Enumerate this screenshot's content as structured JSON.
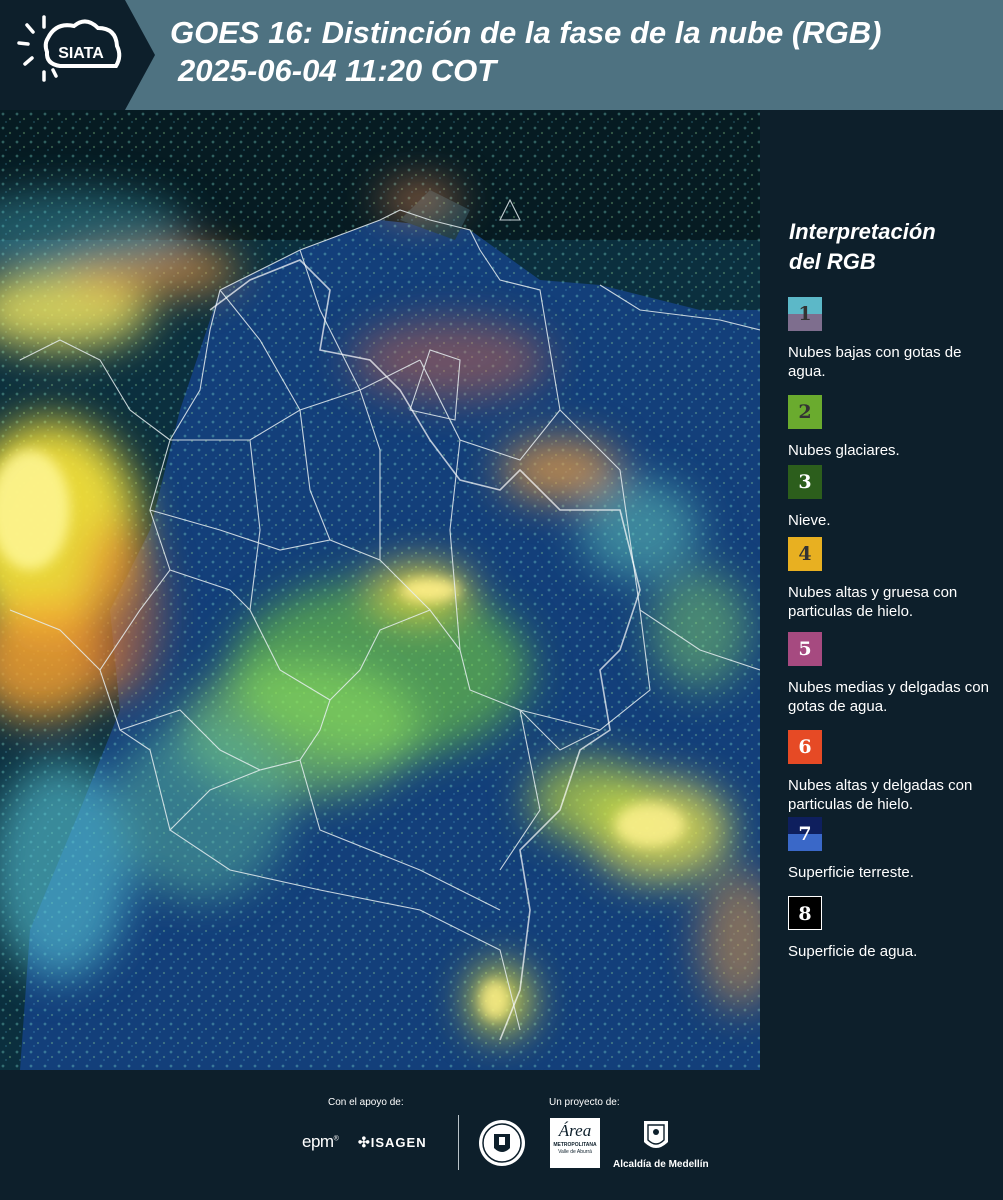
{
  "header": {
    "logo_text": "SIATA",
    "title_line1": "GOES 16: Distinción de la fase de la nube (RGB)",
    "title_line2": "2025-06-04 11:20 COT"
  },
  "legend": {
    "title_line1": "Interpretación",
    "title_line2": "del RGB",
    "items": [
      {
        "number": "1",
        "label": "Nubes bajas con gotas de agua.",
        "color_top": "#5cb8c8",
        "color_bottom": "#7e6e8e"
      },
      {
        "number": "2",
        "label": "Nubes glaciares.",
        "color_top": "#6aab2e",
        "color_bottom": "#6aab2e"
      },
      {
        "number": "3",
        "label": "Nieve.",
        "color_top": "#2c5e1c",
        "color_bottom": "#2c5e1c"
      },
      {
        "number": "4",
        "label": "Nubes altas y gruesa con particulas de hielo.",
        "color_top": "#e8b021",
        "color_bottom": "#e8b021"
      },
      {
        "number": "5",
        "label": "Nubes medias y delgadas con gotas de agua.",
        "color_top": "#a64a80",
        "color_bottom": "#a64a80"
      },
      {
        "number": "6",
        "label": "Nubes altas y delgadas con particulas de hielo.",
        "color_top": "#e64a25",
        "color_bottom": "#e64a25"
      },
      {
        "number": "7",
        "label": "Superficie terreste.",
        "color_top": "#0e1f5e",
        "color_bottom": "#3a68c8"
      },
      {
        "number": "8",
        "label": "Superficie de agua.",
        "color_top": "#000000",
        "color_bottom": "#000000"
      }
    ]
  },
  "footer": {
    "support_label": "Con el apoyo de:",
    "project_label": "Un proyecto de:",
    "sponsor_1": "epm",
    "sponsor_2": "ISAGEN",
    "partner_amva_1": "Área",
    "partner_amva_2": "METROPOLITANA",
    "partner_amva_3": "Valle de Aburrá",
    "partner_alcaldia": "Alcaldía de Medellín"
  }
}
